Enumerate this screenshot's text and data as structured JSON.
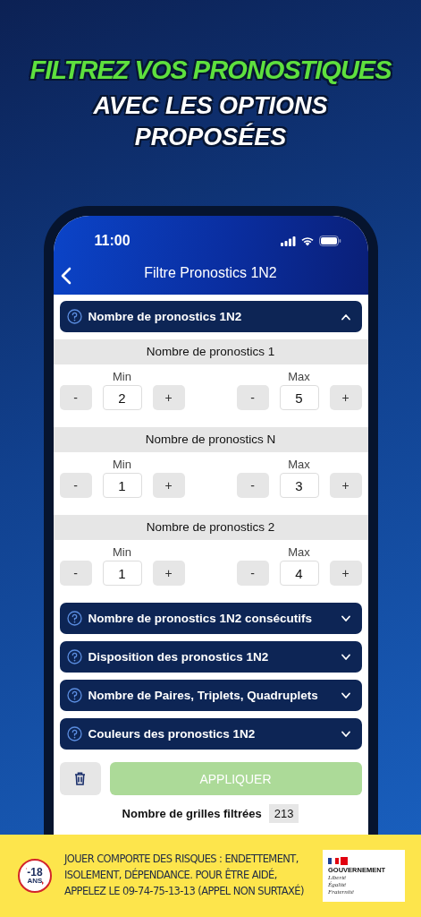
{
  "headline": {
    "title": "FILTREZ VOS PRONOSTIQUES",
    "subtitle": "AVEC LES OPTIONS PROPOSÉES"
  },
  "status_bar": {
    "time": "11:00"
  },
  "nav": {
    "title": "Filtre Pronostics 1N2"
  },
  "sections": [
    {
      "title": "Nombre de pronostics 1N2",
      "expanded": true,
      "groups": [
        {
          "title": "Nombre de pronostics 1",
          "steppers": [
            {
              "label": "Min",
              "value": "2",
              "minus": "-",
              "plus": "+"
            },
            {
              "label": "Max",
              "value": "5",
              "minus": "-",
              "plus": "+"
            }
          ]
        },
        {
          "title": "Nombre de pronostics N",
          "steppers": [
            {
              "label": "Min",
              "value": "1",
              "minus": "-",
              "plus": "+"
            },
            {
              "label": "Max",
              "value": "3",
              "minus": "-",
              "plus": "+"
            }
          ]
        },
        {
          "title": "Nombre de pronostics 2",
          "steppers": [
            {
              "label": "Min",
              "value": "1",
              "minus": "-",
              "plus": "+"
            },
            {
              "label": "Max",
              "value": "4",
              "minus": "-",
              "plus": "+"
            }
          ]
        }
      ]
    },
    {
      "title": "Nombre de pronostics 1N2 consécutifs",
      "expanded": false
    },
    {
      "title": "Disposition des pronostics 1N2",
      "expanded": false
    },
    {
      "title": "Nombre de Paires, Triplets, Quadruplets",
      "expanded": false
    },
    {
      "title": "Couleurs des pronostics 1N2",
      "expanded": false
    }
  ],
  "apply_button": {
    "label": "APPLIQUER",
    "disabled": true
  },
  "result": {
    "label": "Nombre de grilles filtrées",
    "count": "213"
  },
  "banner": {
    "age": "-18",
    "age_unit": "ANS",
    "text": "JOUER COMPORTE DES RISQUES : ENDETTEMENT, ISOLEMENT, DÉPENDANCE. POUR ÊTRE AIDÉ, APPELEZ LE 09-74-75-13-13 (APPEL NON SURTAXÉ)",
    "gov_name": "GOUVERNEMENT",
    "gov_motto": [
      "Liberté",
      "Égalité",
      "Fraternité"
    ]
  }
}
